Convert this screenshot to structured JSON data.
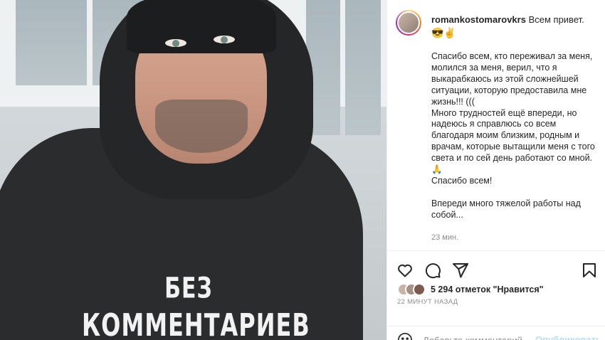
{
  "photo": {
    "shirt_line1": "БЕЗ",
    "shirt_line2": "КОММЕНТАРИЕВ"
  },
  "post": {
    "username": "romankostomarovkrs",
    "greeting": "Всем привет.",
    "emoji": "😎✌",
    "caption": "Спасибо всем, кто переживал за меня, молился за меня, верил, что я выкарабкаюсь из этой сложнейшей ситуации, которую предоставила мне жизнь!!! (((\nМного трудностей ещё впереди, но надеюсь я справлюсь со всем благодаря моим близким, родным и врачам, которые вытащили меня с того света и по сей день работают со мной. 🙏\nСпасибо всем!\n\nВпереди много тяжелой работы над собой...",
    "caption_time": "23 мин."
  },
  "actions": {
    "like_icon": "heart-icon",
    "comment_icon": "comment-icon",
    "share_icon": "send-icon",
    "save_icon": "bookmark-icon",
    "likes_text": "5 294 отметок \"Нравится\"",
    "posted_ago": "22 МИНУТ НАЗАД"
  },
  "comment": {
    "emoji_icon": "smile-icon",
    "placeholder": "Добавьте комментарий...",
    "publish_label": "Опубликовать"
  },
  "colors": {
    "accent": "#0095f6",
    "publish_disabled": "#b2dffc",
    "muted_text": "#8e8e8e",
    "divider": "#efefef"
  }
}
